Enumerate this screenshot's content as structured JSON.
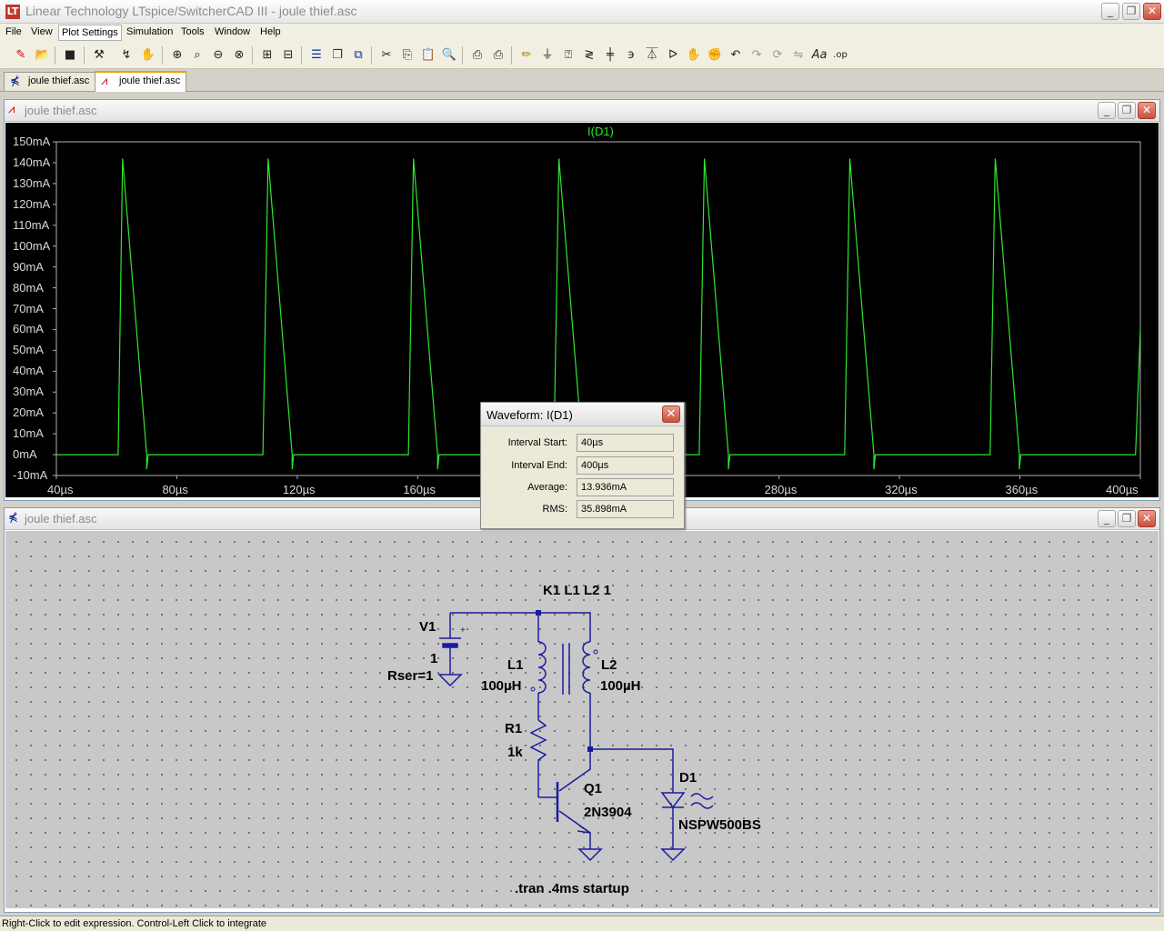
{
  "window": {
    "title": "Linear Technology LTspice/SwitcherCAD III - joule thief.asc",
    "minimize": "_",
    "restore": "❐",
    "close": "✕"
  },
  "menu": [
    "File",
    "View",
    "Plot Settings",
    "Simulation",
    "Tools",
    "Window",
    "Help"
  ],
  "tabs": [
    {
      "label": "joule thief.asc",
      "icon": "schematic-icon"
    },
    {
      "label": "joule thief.asc",
      "icon": "waveform-icon"
    }
  ],
  "plot_window": {
    "title": "joule thief.asc"
  },
  "schematic_window": {
    "title": "joule thief.asc"
  },
  "chart_data": {
    "type": "line",
    "series": [
      {
        "name": "I(D1)",
        "color": "#2ee82e",
        "x_unit": "µs",
        "y_unit": "mA",
        "x": [
          40,
          60.5,
          62,
          70,
          70,
          70.5,
          73,
          108.6,
          110.3,
          118.3,
          118.3,
          118.8,
          121.3,
          156.9,
          158.6,
          166.6,
          166.6,
          167.1,
          169.6,
          205.2,
          206.9,
          214.9,
          214.9,
          215.4,
          217.9,
          253.5,
          255.2,
          263.2,
          263.2,
          263.7,
          266.2,
          301.8,
          303.5,
          311.5,
          311.5,
          312,
          314.5,
          350.1,
          351.8,
          359.8,
          359.8,
          360.3,
          362.8,
          398.4,
          400
        ],
        "y": [
          0,
          0,
          142,
          0,
          -7,
          0,
          0,
          0,
          142,
          0,
          -7,
          0,
          0,
          0,
          142,
          0,
          -7,
          0,
          0,
          0,
          142,
          0,
          -7,
          0,
          0,
          0,
          142,
          0,
          -7,
          0,
          0,
          0,
          142,
          0,
          -7,
          0,
          0,
          0,
          142,
          0,
          -7,
          0,
          0,
          0,
          60
        ]
      }
    ],
    "ylim": [
      -10,
      150
    ],
    "xlim": [
      40,
      400
    ],
    "yticks": [
      "150mA",
      "140mA",
      "130mA",
      "120mA",
      "110mA",
      "100mA",
      "90mA",
      "80mA",
      "70mA",
      "60mA",
      "50mA",
      "40mA",
      "30mA",
      "20mA",
      "10mA",
      "0mA",
      "-10mA"
    ],
    "xticks": [
      "40µs",
      "80µs",
      "120µs",
      "160µs",
      "200µs",
      "240µs",
      "280µs",
      "320µs",
      "360µs",
      "400µs"
    ],
    "grid": false,
    "background": "#000000"
  },
  "waveform_dialog": {
    "title": "Waveform: I(D1)",
    "close": "✕",
    "rows": [
      {
        "label": "Interval Start:",
        "value": "40µs"
      },
      {
        "label": "Interval End:",
        "value": "400µs"
      },
      {
        "label": "Average:",
        "value": "13.936mA"
      },
      {
        "label": "RMS:",
        "value": "35.898mA"
      }
    ]
  },
  "schematic": {
    "coupling": "K1 L1 L2 1",
    "v1_name": "V1",
    "v1_value": "1",
    "v1_rser": "Rser=1",
    "l1_name": "L1",
    "l1_value": "100µH",
    "l2_name": "L2",
    "l2_value": "100µH",
    "r1_name": "R1",
    "r1_value": "1k",
    "q1_name": "Q1",
    "q1_model": "2N3904",
    "d1_name": "D1",
    "d1_model": "NSPW500BS",
    "directive": ".tran .4ms startup",
    "wire_color": "#1a1aa0"
  },
  "statusbar": {
    "text": "Right-Click to edit expression. Control-Left Click to integrate"
  },
  "toolbar_icons": [
    "new-schematic-icon",
    "open-icon",
    "save-icon",
    "control-panel-icon",
    "autorange-icon",
    "pan-icon",
    "zoom-in-icon",
    "zoom-area-icon",
    "zoom-out-icon",
    "zoom-fit-icon",
    "add-trace-icon",
    "delete-trace-icon",
    "tile-horizontal-icon",
    "cascade-icon",
    "close-all-icon",
    "cut-icon",
    "copy-icon",
    "paste-icon",
    "find-icon",
    "print-setup-icon",
    "print-icon",
    "wire-icon",
    "ground-icon",
    "label-icon",
    "resistor-icon",
    "capacitor-icon",
    "inductor-icon",
    "diode-icon",
    "component-icon",
    "move-icon",
    "drag-icon",
    "undo-icon",
    "redo-icon",
    "rotate-icon",
    "mirror-icon",
    "text-icon",
    "spice-directive-icon"
  ]
}
